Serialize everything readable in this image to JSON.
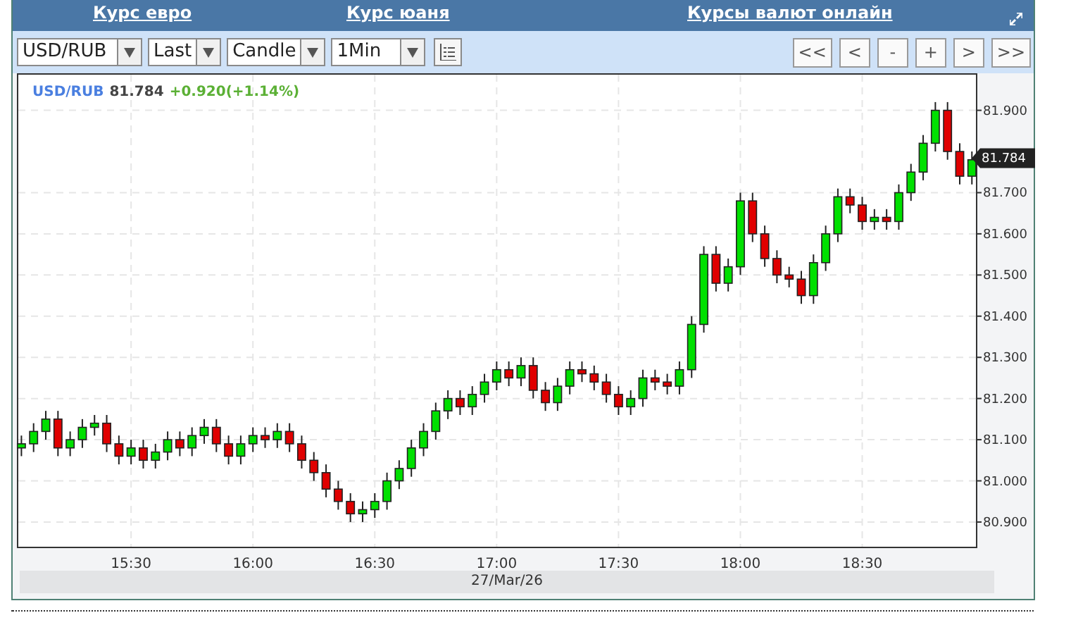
{
  "header": {
    "links": [
      "Курс евро",
      "Курс юаня",
      "Курсы валют онлайн"
    ]
  },
  "toolbar": {
    "selects": [
      {
        "value": "USD/RUB"
      },
      {
        "value": "Last"
      },
      {
        "value": "Candle"
      },
      {
        "value": "1Min"
      }
    ],
    "nav_buttons": [
      "<<",
      "<",
      "-",
      "+",
      ">",
      ">>"
    ]
  },
  "chart": {
    "legend": {
      "symbol": "USD/RUB",
      "price": "81.784",
      "change": "+0.920(+1.14%)"
    },
    "last_price_tag": "81.784",
    "date_label": "27/Mar/26",
    "chart_data": {
      "type": "candlestick",
      "grid": true,
      "ylim": [
        80.84,
        81.99
      ],
      "categories": [
        null,
        null,
        null,
        null,
        null,
        null,
        null,
        null,
        null,
        "15:30",
        null,
        null,
        null,
        null,
        null,
        null,
        null,
        null,
        null,
        "16:00",
        null,
        null,
        null,
        null,
        null,
        null,
        null,
        null,
        null,
        "16:30",
        null,
        null,
        null,
        null,
        null,
        null,
        null,
        null,
        null,
        "17:00",
        null,
        null,
        null,
        null,
        null,
        null,
        null,
        null,
        null,
        "17:30",
        null,
        null,
        null,
        null,
        null,
        null,
        null,
        null,
        null,
        "18:00",
        null,
        null,
        null,
        null,
        null,
        null,
        null,
        null,
        null,
        "18:30",
        null,
        null,
        null,
        null,
        null,
        null,
        null,
        null,
        null
      ],
      "yticks": [
        {
          "value": 80.9,
          "label": "80.900"
        },
        {
          "value": 81.0,
          "label": "81.000"
        },
        {
          "value": 81.1,
          "label": "81.100"
        },
        {
          "value": 81.2,
          "label": "81.200"
        },
        {
          "value": 81.3,
          "label": "81.300"
        },
        {
          "value": 81.4,
          "label": "81.400"
        },
        {
          "value": 81.5,
          "label": "81.500"
        },
        {
          "value": 81.6,
          "label": "81.600"
        },
        {
          "value": 81.7,
          "label": "81.700"
        },
        {
          "value": 81.9,
          "label": "81.900"
        }
      ],
      "ohlc": [
        [
          81.08,
          81.11,
          81.06,
          81.09
        ],
        [
          81.09,
          81.14,
          81.07,
          81.12
        ],
        [
          81.12,
          81.17,
          81.1,
          81.15
        ],
        [
          81.15,
          81.17,
          81.06,
          81.08
        ],
        [
          81.08,
          81.12,
          81.06,
          81.1
        ],
        [
          81.1,
          81.15,
          81.08,
          81.13
        ],
        [
          81.13,
          81.16,
          81.11,
          81.14
        ],
        [
          81.14,
          81.16,
          81.07,
          81.09
        ],
        [
          81.09,
          81.11,
          81.04,
          81.06
        ],
        [
          81.06,
          81.1,
          81.04,
          81.08
        ],
        [
          81.08,
          81.1,
          81.03,
          81.05
        ],
        [
          81.05,
          81.09,
          81.03,
          81.07
        ],
        [
          81.07,
          81.12,
          81.05,
          81.1
        ],
        [
          81.1,
          81.12,
          81.06,
          81.08
        ],
        [
          81.08,
          81.13,
          81.06,
          81.11
        ],
        [
          81.11,
          81.15,
          81.09,
          81.13
        ],
        [
          81.13,
          81.15,
          81.07,
          81.09
        ],
        [
          81.09,
          81.11,
          81.04,
          81.06
        ],
        [
          81.06,
          81.11,
          81.04,
          81.09
        ],
        [
          81.09,
          81.13,
          81.07,
          81.11
        ],
        [
          81.11,
          81.13,
          81.08,
          81.1
        ],
        [
          81.1,
          81.14,
          81.08,
          81.12
        ],
        [
          81.12,
          81.14,
          81.07,
          81.09
        ],
        [
          81.09,
          81.11,
          81.03,
          81.05
        ],
        [
          81.05,
          81.07,
          81.0,
          81.02
        ],
        [
          81.02,
          81.04,
          80.96,
          80.98
        ],
        [
          80.98,
          81.0,
          80.93,
          80.95
        ],
        [
          80.95,
          80.97,
          80.9,
          80.92
        ],
        [
          80.92,
          80.95,
          80.9,
          80.93
        ],
        [
          80.93,
          80.97,
          80.91,
          80.95
        ],
        [
          80.95,
          81.02,
          80.93,
          81.0
        ],
        [
          81.0,
          81.05,
          80.98,
          81.03
        ],
        [
          81.03,
          81.1,
          81.01,
          81.08
        ],
        [
          81.08,
          81.14,
          81.06,
          81.12
        ],
        [
          81.12,
          81.19,
          81.1,
          81.17
        ],
        [
          81.17,
          81.22,
          81.15,
          81.2
        ],
        [
          81.2,
          81.22,
          81.16,
          81.18
        ],
        [
          81.18,
          81.23,
          81.16,
          81.21
        ],
        [
          81.21,
          81.26,
          81.19,
          81.24
        ],
        [
          81.24,
          81.29,
          81.22,
          81.27
        ],
        [
          81.27,
          81.29,
          81.23,
          81.25
        ],
        [
          81.25,
          81.3,
          81.23,
          81.28
        ],
        [
          81.28,
          81.3,
          81.2,
          81.22
        ],
        [
          81.22,
          81.24,
          81.17,
          81.19
        ],
        [
          81.19,
          81.25,
          81.17,
          81.23
        ],
        [
          81.23,
          81.29,
          81.21,
          81.27
        ],
        [
          81.27,
          81.29,
          81.24,
          81.26
        ],
        [
          81.26,
          81.28,
          81.22,
          81.24
        ],
        [
          81.24,
          81.26,
          81.19,
          81.21
        ],
        [
          81.21,
          81.23,
          81.16,
          81.18
        ],
        [
          81.18,
          81.22,
          81.16,
          81.2
        ],
        [
          81.2,
          81.27,
          81.18,
          81.25
        ],
        [
          81.25,
          81.27,
          81.22,
          81.24
        ],
        [
          81.24,
          81.26,
          81.21,
          81.23
        ],
        [
          81.23,
          81.29,
          81.21,
          81.27
        ],
        [
          81.27,
          81.4,
          81.25,
          81.38
        ],
        [
          81.38,
          81.57,
          81.36,
          81.55
        ],
        [
          81.55,
          81.57,
          81.46,
          81.48
        ],
        [
          81.48,
          81.54,
          81.46,
          81.52
        ],
        [
          81.52,
          81.7,
          81.5,
          81.68
        ],
        [
          81.68,
          81.7,
          81.58,
          81.6
        ],
        [
          81.6,
          81.62,
          81.52,
          81.54
        ],
        [
          81.54,
          81.56,
          81.48,
          81.5
        ],
        [
          81.5,
          81.52,
          81.47,
          81.49
        ],
        [
          81.49,
          81.51,
          81.43,
          81.45
        ],
        [
          81.45,
          81.55,
          81.43,
          81.53
        ],
        [
          81.53,
          81.62,
          81.51,
          81.6
        ],
        [
          81.6,
          81.71,
          81.58,
          81.69
        ],
        [
          81.69,
          81.71,
          81.65,
          81.67
        ],
        [
          81.67,
          81.69,
          81.61,
          81.63
        ],
        [
          81.63,
          81.66,
          81.61,
          81.64
        ],
        [
          81.64,
          81.66,
          81.61,
          81.63
        ],
        [
          81.63,
          81.72,
          81.61,
          81.7
        ],
        [
          81.7,
          81.77,
          81.68,
          81.75
        ],
        [
          81.75,
          81.84,
          81.73,
          81.82
        ],
        [
          81.82,
          81.92,
          81.8,
          81.9
        ],
        [
          81.9,
          81.92,
          81.78,
          81.8
        ],
        [
          81.8,
          81.82,
          81.72,
          81.74
        ],
        [
          81.74,
          81.8,
          81.72,
          81.78
        ]
      ]
    }
  }
}
